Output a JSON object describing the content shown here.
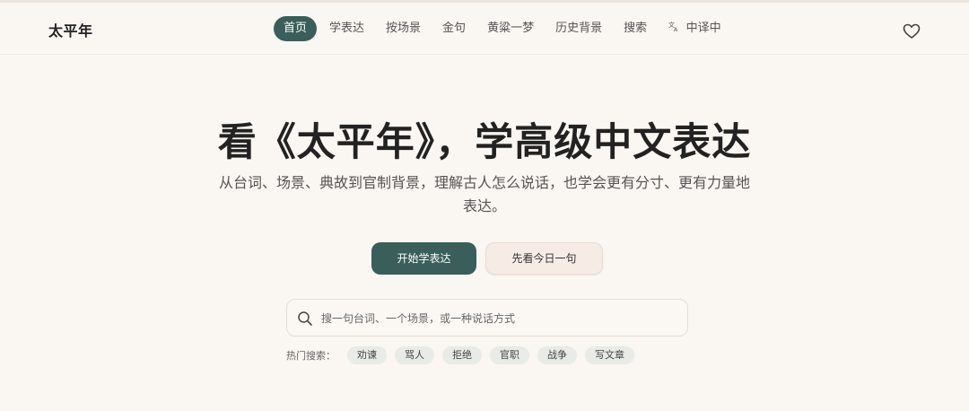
{
  "brand": "太平年",
  "nav": {
    "items": [
      {
        "label": "首页",
        "active": true
      },
      {
        "label": "学表达"
      },
      {
        "label": "按场景"
      },
      {
        "label": "金句"
      },
      {
        "label": "黄粱一梦"
      },
      {
        "label": "历史背景"
      },
      {
        "label": "搜索"
      },
      {
        "label": "中译中",
        "icon": "translate-icon"
      }
    ]
  },
  "header": {
    "favorites_icon": "heart-icon"
  },
  "hero": {
    "title": "看《太平年》，学高级中文表达",
    "subtitle": "从台词、场景、典故到官制背景，理解古人怎么说话，也学会更有分寸、更有力量地表达。",
    "primary_button": "开始学表达",
    "secondary_button": "先看今日一句"
  },
  "search": {
    "placeholder": "搜一句台词、一个场景，或一种说话方式",
    "icon": "search-icon"
  },
  "hot_search": {
    "label": "热门搜索：",
    "tags": [
      "劝谏",
      "骂人",
      "拒绝",
      "官职",
      "战争",
      "写文章"
    ]
  },
  "colors": {
    "accent": "#3a5e5a",
    "background": "#faf6f1",
    "secondary_button_bg": "#f6ece5",
    "tag_bg": "#e9ebe6"
  }
}
